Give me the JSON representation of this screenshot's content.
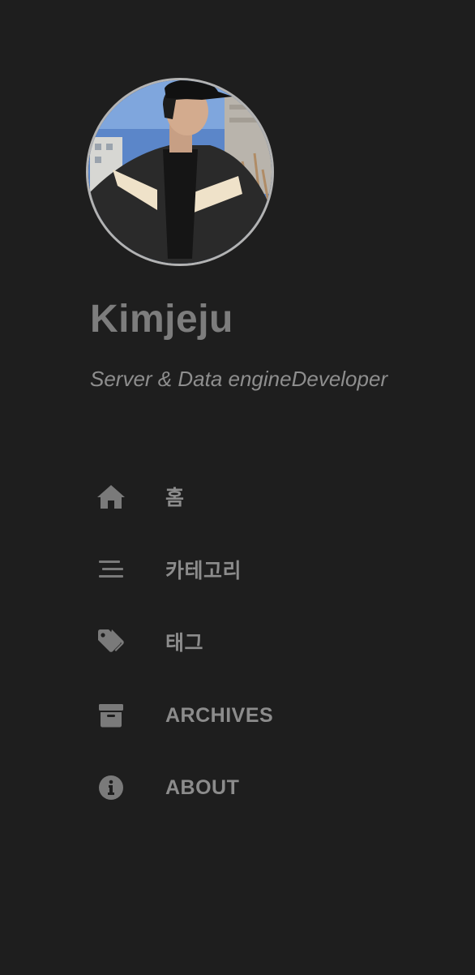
{
  "profile": {
    "avatar_alt": "avatar",
    "name": "Kimjeju",
    "subtitle": "Server & Data engineDeveloper"
  },
  "nav": {
    "items": [
      {
        "label": "홈",
        "icon": "home-icon"
      },
      {
        "label": "카테고리",
        "icon": "stream-icon"
      },
      {
        "label": "태그",
        "icon": "tags-icon"
      },
      {
        "label": "ARCHIVES",
        "icon": "archive-icon"
      },
      {
        "label": "ABOUT",
        "icon": "info-circle-icon"
      }
    ]
  },
  "colors": {
    "background": "#1e1e1e",
    "text": "#8a8a8a",
    "icon": "#7a7a7a",
    "avatar_border": "#b3b3b3"
  }
}
